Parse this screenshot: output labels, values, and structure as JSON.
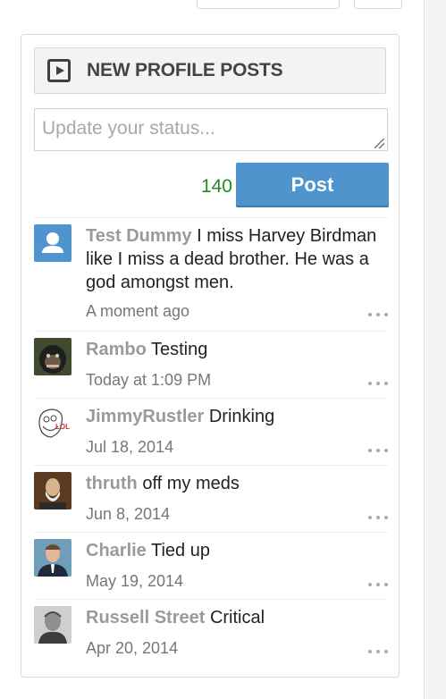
{
  "panel": {
    "title": "NEW PROFILE POSTS",
    "status_placeholder": "Update your status...",
    "char_count": "140",
    "post_button": "Post"
  },
  "posts": [
    {
      "user": "Test Dummy",
      "message": "I miss Harvey Birdman like I miss a dead brother. He was a god amongst men.",
      "time": "A moment ago",
      "avatar": "default-user-avatar"
    },
    {
      "user": "Rambo",
      "message": "Testing",
      "time": "Today at 1:09 PM",
      "avatar": "monkey-photo-avatar"
    },
    {
      "user": "JimmyRustler",
      "message": "Drinking",
      "time": "Jul 18, 2014",
      "avatar": "lol-face-avatar"
    },
    {
      "user": "thruth",
      "message": "off my meds",
      "time": "Jun 8, 2014",
      "avatar": "bearded-man-portrait-avatar"
    },
    {
      "user": "Charlie",
      "message": "Tied up",
      "time": "May 19, 2014",
      "avatar": "man-in-suit-avatar"
    },
    {
      "user": "Russell Street",
      "message": "Critical",
      "time": "Apr 20, 2014",
      "avatar": "gray-portrait-avatar"
    }
  ],
  "colors": {
    "accent": "#4f94cd",
    "counter": "#228b22",
    "username": "#9a9a9a"
  }
}
